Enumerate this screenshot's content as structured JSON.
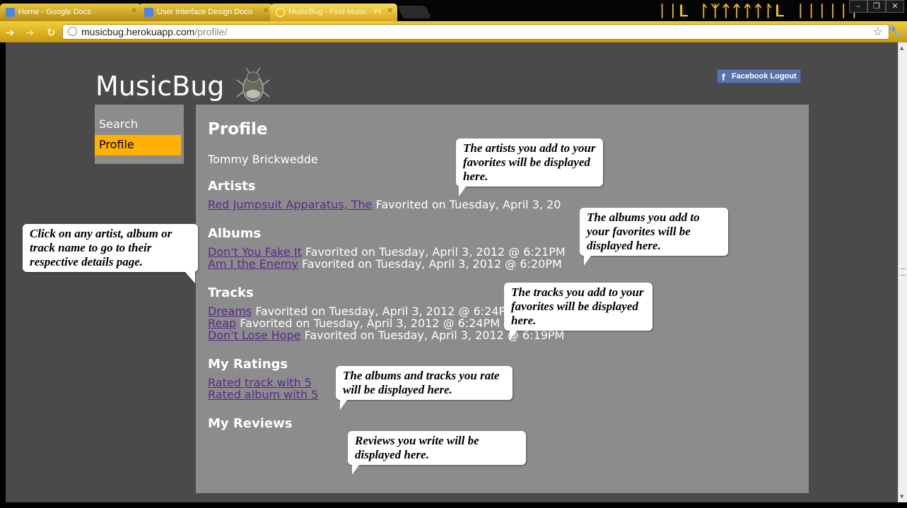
{
  "browser": {
    "tabs": [
      {
        "title": "Home - Google Docs",
        "icon": "docs-icon",
        "color": "#4a86e8"
      },
      {
        "title": "User Interface Design Docu",
        "icon": "document-icon",
        "color": "#4a86e8"
      },
      {
        "title": "MusicBug - Find Music - Pi",
        "icon": "globe-icon",
        "color": "#f0c020"
      }
    ],
    "theme_logo": "ᛁᛁᒪ ᛚᛉᛏᛏᛏᛏᛚᒪ ᛁᛁᛁᛁᛁᛏ",
    "url_host": "musicbug.herokuapp.com",
    "url_path": "/profile/"
  },
  "site": {
    "brand": "MusicBug",
    "fb_logout": "Facebook Logout"
  },
  "nav": {
    "items": [
      "Search",
      "Profile"
    ],
    "active": "Profile"
  },
  "profile": {
    "title": "Profile",
    "user_name": "Tommy Brickwedde",
    "artists_heading": "Artists",
    "artists": [
      {
        "name": "Red Jumpsuit Apparatus, The",
        "meta": " Favorited on Tuesday, April 3, 20"
      }
    ],
    "albums_heading": "Albums",
    "albums": [
      {
        "name": "Don't You Fake It",
        "meta": " Favorited on Tuesday, April 3, 2012 @ 6:21PM"
      },
      {
        "name": "Am I the Enemy",
        "meta": " Favorited on Tuesday, April 3, 2012 @ 6:20PM"
      }
    ],
    "tracks_heading": "Tracks",
    "tracks": [
      {
        "name": "Dreams",
        "meta": " Favorited on Tuesday, April 3, 2012 @ 6:24PM"
      },
      {
        "name": "Reap",
        "meta": " Favorited on Tuesday, April 3, 2012 @ 6:24PM"
      },
      {
        "name": "Don't Lose Hope",
        "meta": " Favorited on Tuesday, April 3, 2012 @ 6:19PM"
      }
    ],
    "ratings_heading": "My Ratings",
    "ratings": [
      "Rated track with 5",
      "Rated album with 5"
    ],
    "reviews_heading": "My Reviews"
  },
  "callouts": {
    "artists": "The artists you add to your favorites will be displayed here.",
    "albums": "The albums you add to your favorites will be displayed here.",
    "tracks": "The tracks you add to your favorites will be displayed here.",
    "ratings": "The albums and tracks you rate will be displayed here.",
    "reviews": "Reviews you write will be displayed here.",
    "click_hint": "Click on any artist, album or track name to go to their respective details page."
  },
  "colors": {
    "page_bg": "#4a4a4a",
    "panel_bg": "#8c8c8c",
    "active_nav": "#ffb000",
    "link": "#5b2a8a",
    "chrome_gold": "#e0b020"
  }
}
